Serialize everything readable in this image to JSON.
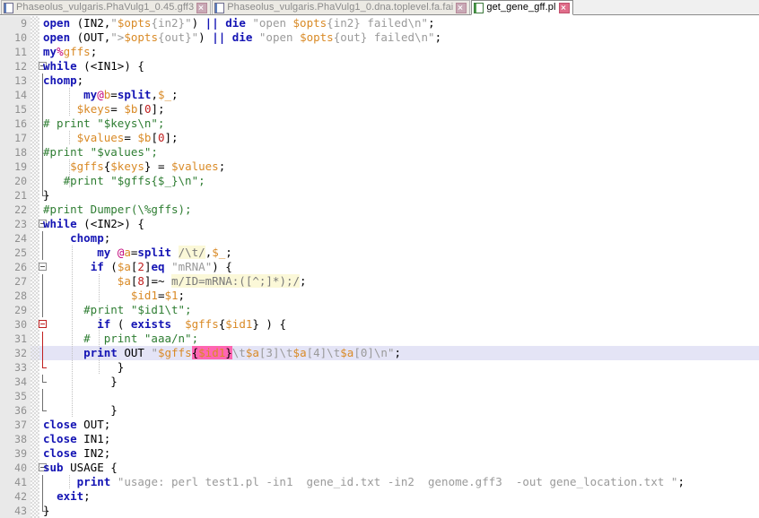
{
  "window": {
    "title": "get_gene_gff.pl",
    "app_kind": "text-editor"
  },
  "tabs": [
    {
      "label": "Phaseolus_vulgaris.PhaVulg1_0.45.gff3",
      "active": false,
      "close_icon": "close-icon",
      "file_icon": "file-icon"
    },
    {
      "label": "Phaseolus_vulgaris.PhaVulg1_0.dna.toplevel.fa.fai",
      "active": false,
      "close_icon": "close-icon",
      "file_icon": "file-icon"
    },
    {
      "label": "get_gene_gff.pl",
      "active": true,
      "close_icon": "close-icon",
      "file_icon": "file-icon"
    }
  ],
  "editor": {
    "language": "perl",
    "current_line": 32,
    "first_visible_line": 9,
    "last_visible_line": 43,
    "colors": {
      "keyword": "#1414b4",
      "variable": "#d98a26",
      "number": "#c02020",
      "string": "#9a9a9a",
      "comment": "#2e7d32",
      "sigil": "#c0007a",
      "regex_background": "#fbf8d8",
      "current_line_background": "#e4e4f6",
      "gutter_background": "#e9e9e9",
      "gutter_text": "#8f8f8f",
      "matched_bracket": "#ff66b2",
      "fold_line_active": "#c02020"
    },
    "lines": [
      {
        "n": 9,
        "text": "  open (IN2,\"$opts{in2}\") || die \"open $opts{in2} failed\\n\";"
      },
      {
        "n": 10,
        "text": "  open (OUT,\">$opts{out}\") || die \"open $opts{out} failed\\n\";"
      },
      {
        "n": 11,
        "text": "  my%gffs;"
      },
      {
        "n": 12,
        "text": "while (<IN1>) {"
      },
      {
        "n": 13,
        "text": "  chomp;"
      },
      {
        "n": 14,
        "text": "        my@b=split,$_;"
      },
      {
        "n": 15,
        "text": "       $keys= $b[0];"
      },
      {
        "n": 16,
        "text": " # print \"$keys\\n\";"
      },
      {
        "n": 17,
        "text": "       $values= $b[0];"
      },
      {
        "n": 18,
        "text": " #print \"$values\";"
      },
      {
        "n": 19,
        "text": "      $gffs{$keys} = $values;"
      },
      {
        "n": 20,
        "text": "      #print \"$gffs{$_}\\n\";"
      },
      {
        "n": 21,
        "text": " }"
      },
      {
        "n": 22,
        "text": "  #print Dumper(\\%gffs);"
      },
      {
        "n": 23,
        "text": "while (<IN2>) {"
      },
      {
        "n": 24,
        "text": "      chomp;"
      },
      {
        "n": 25,
        "text": "          my @a=split /\\t/,$_;"
      },
      {
        "n": 26,
        "text": "         if ($a[2]eq \"mRNA\") {"
      },
      {
        "n": 27,
        "text": "             $a[8]=~ m/ID=mRNA:([^;]*);/;"
      },
      {
        "n": 28,
        "text": "               $id1=$1;"
      },
      {
        "n": 29,
        "text": "        #print \"$id1\\t\";"
      },
      {
        "n": 30,
        "text": "          if ( exists  $gffs{$id1} ) {"
      },
      {
        "n": 31,
        "text": "        #  print \"aaa/n\";"
      },
      {
        "n": 32,
        "text": "        print OUT \"$gffs{$id1}\\t$a[3]\\t$a[4]\\t$a[0]\\n\";"
      },
      {
        "n": 33,
        "text": "             }"
      },
      {
        "n": 34,
        "text": "            }"
      },
      {
        "n": 35,
        "text": ""
      },
      {
        "n": 36,
        "text": "            }"
      },
      {
        "n": 37,
        "text": "  close OUT;"
      },
      {
        "n": 38,
        "text": "  close IN1;"
      },
      {
        "n": 39,
        "text": "  close IN2;"
      },
      {
        "n": 40,
        "text": "sub USAGE {"
      },
      {
        "n": 41,
        "text": "      print \"usage: perl test1.pl -in1  gene_id.txt -in2  genome.gff3  -out gene_location.txt \";"
      },
      {
        "n": 42,
        "text": "   exit;"
      },
      {
        "n": 43,
        "text": " }"
      }
    ]
  }
}
